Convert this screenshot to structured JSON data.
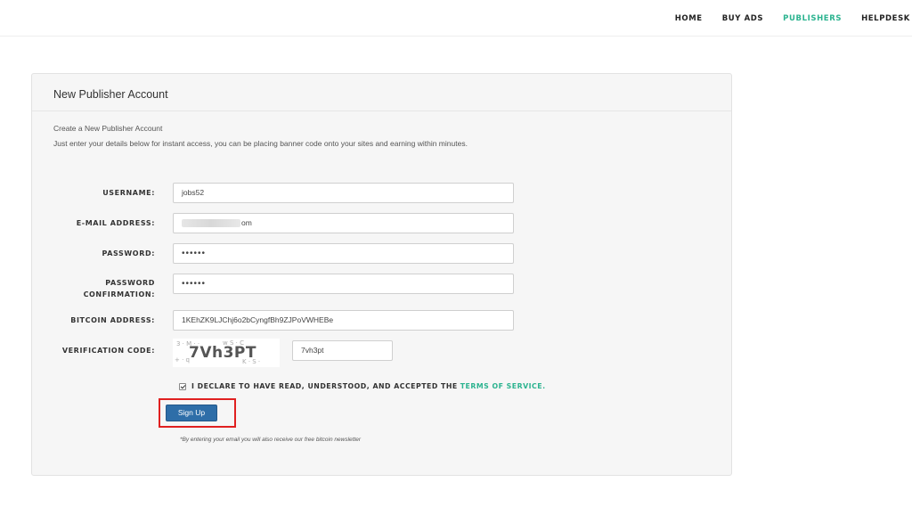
{
  "nav": {
    "items": [
      {
        "label": "HOME",
        "active": false
      },
      {
        "label": "BUY ADS",
        "active": false
      },
      {
        "label": "PUBLISHERS",
        "active": true
      },
      {
        "label": "HELPDESK",
        "active": false
      }
    ],
    "accent_color": "#2bb38f"
  },
  "panel": {
    "title": "New Publisher Account",
    "intro_line1": "Create a New Publisher Account",
    "intro_line2": "Just enter your details below for instant access, you can be placing banner code onto your sites and earning within minutes."
  },
  "form": {
    "username": {
      "label": "USERNAME:",
      "value": "jobs52"
    },
    "email": {
      "label": "E-MAIL ADDRESS:",
      "value_prefix": "",
      "value_suffix": "om"
    },
    "password": {
      "label": "PASSWORD:",
      "value": "••••••"
    },
    "password_confirmation": {
      "label_line1": "PASSWORD",
      "label_line2": "CONFIRMATION:",
      "value": "••••••"
    },
    "bitcoin": {
      "label": "BITCOIN ADDRESS:",
      "value": "1KEhZK9LJChj6o2bCyngfBh9ZJPoVWHEBe"
    },
    "verification": {
      "label": "VERIFICATION CODE:",
      "captcha_text": "7Vh3PT",
      "value": "7vh3pt"
    },
    "declare": {
      "text": "I DECLARE TO HAVE READ, UNDERSTOOD, AND ACCEPTED THE",
      "link": "TERMS OF SERVICE",
      "end": ".",
      "checked": true
    },
    "submit_label": "Sign Up",
    "newsletter_note": "*By entering your email you will also receive our free bitcoin newsletter"
  },
  "colors": {
    "button": "#2e6ea8",
    "highlight_box": "#e02020"
  }
}
